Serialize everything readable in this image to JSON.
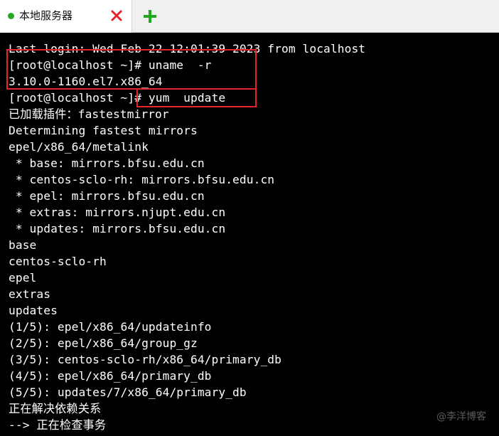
{
  "tab": {
    "label": "本地服务器",
    "status_color": "#2aa52a",
    "close_icon_color": "#e8232a",
    "add_icon_color": "#22a622"
  },
  "terminal": {
    "lines": [
      "Last login: Wed Feb 22 12:01:39 2023 from localhost",
      "[root@localhost ~]# uname  -r",
      "3.10.0-1160.el7.x86_64",
      "[root@localhost ~]# yum  update",
      "已加载插件：fastestmirror",
      "Determining fastest mirrors",
      "epel/x86_64/metalink",
      " * base: mirrors.bfsu.edu.cn",
      " * centos-sclo-rh: mirrors.bfsu.edu.cn",
      " * epel: mirrors.bfsu.edu.cn",
      " * extras: mirrors.njupt.edu.cn",
      " * updates: mirrors.bfsu.edu.cn",
      "base",
      "centos-sclo-rh",
      "epel",
      "extras",
      "updates",
      "(1/5): epel/x86_64/updateinfo",
      "(2/5): epel/x86_64/group_gz",
      "(3/5): centos-sclo-rh/x86_64/primary_db",
      "(4/5): epel/x86_64/primary_db",
      "(5/5): updates/7/x86_64/primary_db",
      "正在解决依赖关系",
      "--> 正在检查事务"
    ],
    "highlight_color": "#e8232a"
  },
  "watermark": "@李洋博客"
}
